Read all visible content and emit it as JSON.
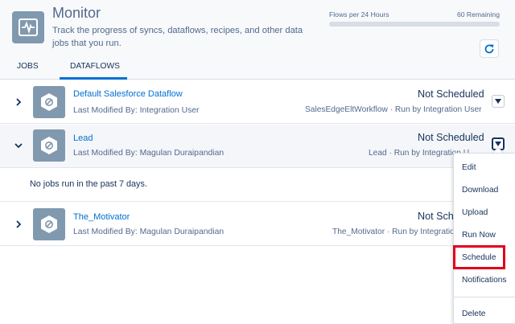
{
  "header": {
    "title": "Monitor",
    "subtitle": "Track the progress of syncs, dataflows, recipes, and other data jobs that you run.",
    "flows_label": "Flows per 24 Hours",
    "flows_remaining": "60 Remaining",
    "flows_used_fraction": 0.0,
    "icon": "monitor-heartbeat-icon",
    "refresh_icon": "refresh-icon"
  },
  "tabs": [
    {
      "label": "JOBS",
      "selected": false
    },
    {
      "label": "DATAFLOWS",
      "selected": true
    }
  ],
  "rows": [
    {
      "name": "Default Salesforce Dataflow",
      "modified": "Last Modified By: Integration User",
      "status": "Not Scheduled",
      "run_info": "SalesEdgeEltWorkflow · Run by Integration User",
      "expanded": false
    },
    {
      "name": "Lead",
      "modified": "Last Modified By: Magulan Duraipandian",
      "status": "Not Scheduled",
      "run_info": "Lead · Run by Integration U",
      "expanded": true
    },
    {
      "name": "The_Motivator",
      "modified": "Last Modified By: Magulan Duraipandian",
      "status": "Not Sched",
      "run_info": "The_Motivator · Run by Integratio",
      "expanded": false
    }
  ],
  "expanded_panel": {
    "empty_text": "No jobs run in the past 7 days."
  },
  "menu": {
    "items": [
      "Edit",
      "Download",
      "Upload",
      "Run Now",
      "Schedule",
      "Notifications",
      "Delete"
    ],
    "highlighted": "Schedule"
  },
  "colors": {
    "accent": "#0070d2",
    "icon_bg": "#8199af",
    "highlight": "#e0001b"
  }
}
